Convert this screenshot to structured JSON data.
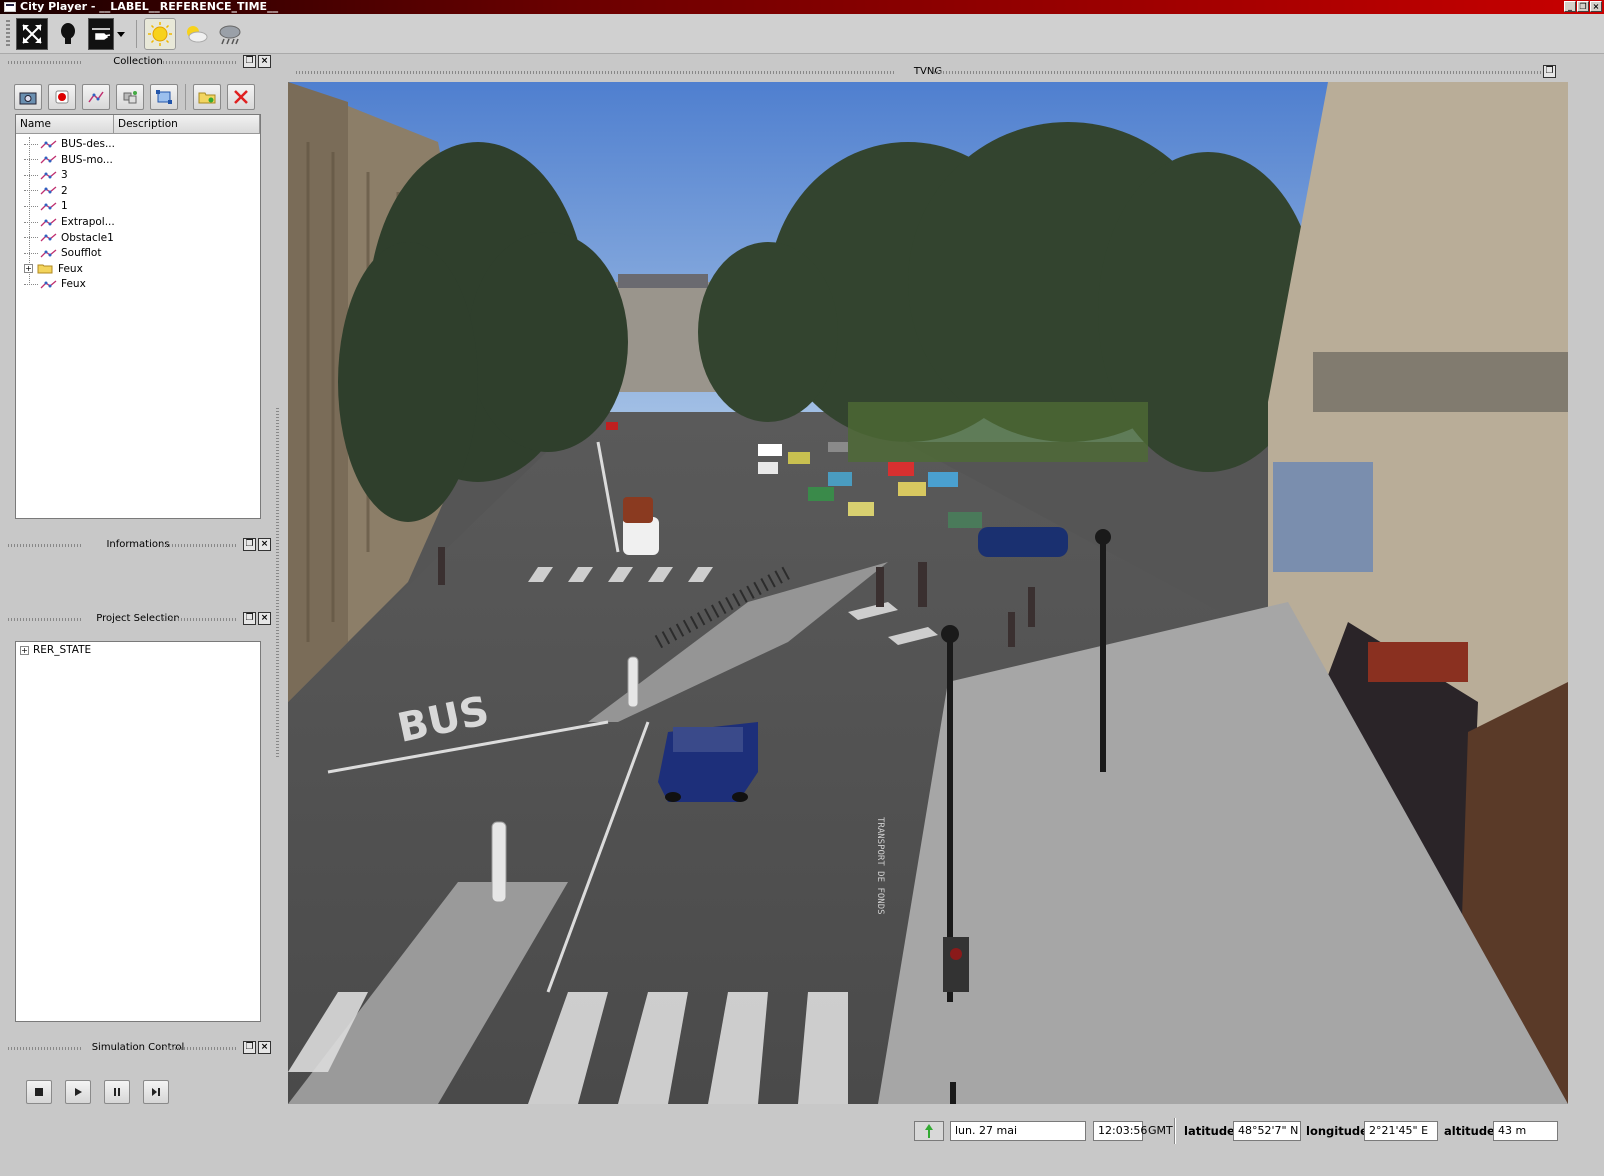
{
  "window": {
    "title": "City Player - __LABEL__REFERENCE_TIME__"
  },
  "toolbar": {
    "buttons": [
      {
        "icon": "arrows-expand-icon",
        "label": ""
      },
      {
        "icon": "lightbulb-icon",
        "label": ""
      },
      {
        "icon": "helicopter-icon",
        "label": ""
      },
      {
        "icon": "sun-icon",
        "label": ""
      },
      {
        "icon": "partly-cloudy-icon",
        "label": ""
      },
      {
        "icon": "rain-cloud-icon",
        "label": ""
      }
    ]
  },
  "collection": {
    "title": "Collection",
    "columns": [
      "Name",
      "Description"
    ],
    "items": [
      {
        "name": "BUS-des...",
        "icon": "path-icon"
      },
      {
        "name": "BUS-mo...",
        "icon": "path-icon"
      },
      {
        "name": "3",
        "icon": "path-icon"
      },
      {
        "name": "2",
        "icon": "path-icon"
      },
      {
        "name": "1",
        "icon": "path-icon"
      },
      {
        "name": "Extrapol...",
        "icon": "path-icon"
      },
      {
        "name": "Obstacle1",
        "icon": "path-icon"
      },
      {
        "name": "Soufflot",
        "icon": "path-icon"
      },
      {
        "name": "Feux",
        "icon": "folder-icon",
        "expandable": true
      },
      {
        "name": "Feux",
        "icon": "path-icon"
      }
    ]
  },
  "informations": {
    "title": "Informations"
  },
  "project_selection": {
    "title": "Project Selection",
    "items": [
      {
        "name": "RER_STATE",
        "expandable": true
      }
    ]
  },
  "simulation_control": {
    "title": "Simulation Control",
    "buttons": [
      "stop-icon",
      "play-icon",
      "pause-icon",
      "step-icon"
    ]
  },
  "view": {
    "title": "TVNG",
    "road_marking": "BUS",
    "road_text": "TRANSPORT DE FONDS"
  },
  "statusbar": {
    "date": "lun. 27 mai",
    "time": "12:03:56",
    "timezone": "GMT",
    "latitude_label": "latitude",
    "latitude": "48°52'7\" N",
    "longitude_label": "longitude",
    "longitude": "2°21'45\" E",
    "altitude_label": "altitude",
    "altitude": "43 m"
  },
  "colors": {
    "sky": "#7ea4d6",
    "titlebar": "#c80000",
    "background": "#c8c8c8"
  }
}
